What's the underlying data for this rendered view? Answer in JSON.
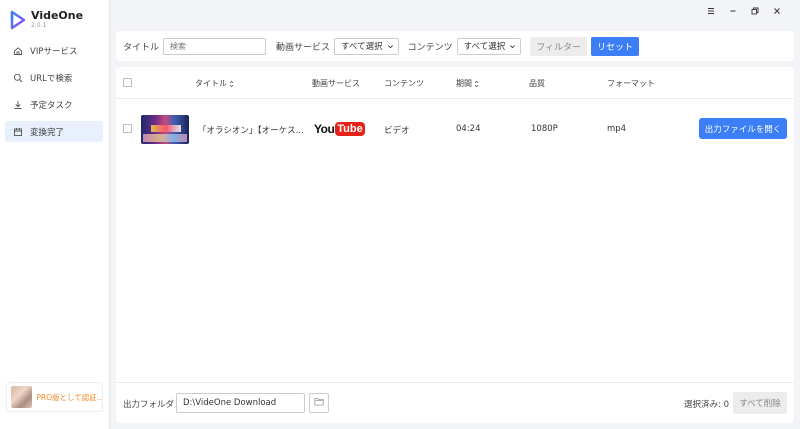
{
  "app": {
    "name": "VideOne",
    "version": "2.0.1"
  },
  "window_controls": [
    {
      "icon": "menu-icon"
    },
    {
      "icon": "minimize-icon"
    },
    {
      "icon": "restore-icon"
    },
    {
      "icon": "close-icon"
    }
  ],
  "sidebar": {
    "items": [
      {
        "label": "VIPサービス",
        "icon": "home-icon",
        "active": false
      },
      {
        "label": "URLで検索",
        "icon": "search-icon",
        "active": false
      },
      {
        "label": "予定タスク",
        "icon": "download-icon",
        "active": false
      },
      {
        "label": "変換完了",
        "icon": "calendar-icon",
        "active": true
      }
    ],
    "promo": "PRO版として認証..."
  },
  "filter": {
    "title_label": "タイトル",
    "search_placeholder": "検索",
    "service_label": "動画サービス",
    "service_value": "すべて選択",
    "content_label": "コンテンツ",
    "content_value": "すべて選択",
    "filter_button": "フィルター",
    "reset_button": "リセット"
  },
  "table": {
    "headers": {
      "title": "タイトル",
      "service": "動画サービス",
      "content": "コンテンツ",
      "duration": "期間",
      "quality": "品質",
      "format": "フォーマット"
    },
    "rows": [
      {
        "title": "「オラシオン」【オーケス...",
        "service": "YouTube",
        "service_parts": [
          "You",
          "Tube"
        ],
        "content": "ビデオ",
        "duration": "04:24",
        "quality": "1080P",
        "format": "mp4",
        "action": "出力ファイルを開く"
      }
    ]
  },
  "footer": {
    "output_label": "出力フォルダ",
    "output_path": "D:\\VideOne Download",
    "selected": "選択済み: 0",
    "delete_all": "すべて削除"
  },
  "colors": {
    "accent": "#3b7ef6",
    "active_nav_bg": "#e8f0fd",
    "youtube_red": "#e62117",
    "promo_text": "#f08a2b"
  }
}
